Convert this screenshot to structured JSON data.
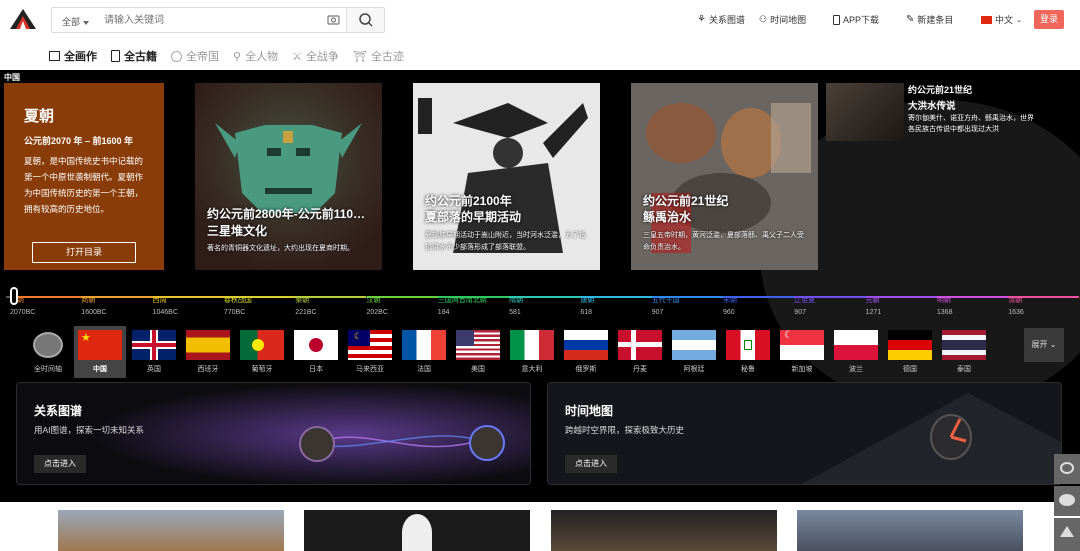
{
  "header": {
    "search_scope": "全部",
    "search_placeholder": "请输入关键词",
    "nav": [
      "关系图谱",
      "时间地图",
      "APP下载",
      "新建条目",
      "中文"
    ],
    "login": "登录"
  },
  "categories": [
    "全画作",
    "全古籍",
    "全帝国",
    "全人物",
    "全战争",
    "全古迹"
  ],
  "hero": {
    "label": "中国",
    "card": {
      "title": "夏朝",
      "dates": "公元前2070 年 – 前1600 年",
      "desc": "夏朝，是中国传统史书中记载的第一个中原世袭制朝代。夏朝作为中国传统历史的第一个王朝，拥有较高的历史地位。",
      "button": "打开目录"
    },
    "pictures": [
      {
        "title1": "约公元前2800年-公元前110…",
        "title2": "三星堆文化",
        "desc": "著名的青铜器文化遗址，大约出现在夏商时期。"
      },
      {
        "title1": "约公元前2100年",
        "title2": "夏部落的早期活动",
        "desc": "夏部族早期活动于嵩山附近，当时河水泛滥，为了抵抗洪水不少部落形成了部落联盟。"
      },
      {
        "title1": "约公元前21世纪",
        "title2": "鲧禹治水",
        "desc": "三皇五帝时期，黄河泛滥，夏部落鲧、禹父子二人受命负责治水。"
      }
    ],
    "side": {
      "title": "约公元前21世纪",
      "subtitle": "大洪水传说",
      "desc": "寄尔伽美什、诺亚方舟、鲧禹治水，世界各民族古传说中都出现过大洪"
    }
  },
  "timeline": [
    {
      "name": "夏朝",
      "year": "2070BC",
      "color": "#f07a2a"
    },
    {
      "name": "商朝",
      "year": "1600BC",
      "color": "#f0a030"
    },
    {
      "name": "西周",
      "year": "1046BC",
      "color": "#e8c230"
    },
    {
      "name": "春秋战国",
      "year": "770BC",
      "color": "#d8d030"
    },
    {
      "name": "秦朝",
      "year": "221BC",
      "color": "#b8d040"
    },
    {
      "name": "汉朝",
      "year": "202BC",
      "color": "#6cd040"
    },
    {
      "name": "三国两晋南北朝",
      "year": "184",
      "color": "#30c860"
    },
    {
      "name": "隋朝",
      "year": "581",
      "color": "#30c8b0"
    },
    {
      "name": "唐朝",
      "year": "618",
      "color": "#30b8e0"
    },
    {
      "name": "五代十国",
      "year": "907",
      "color": "#3088f0"
    },
    {
      "name": "宋朝",
      "year": "960",
      "color": "#4060f0"
    },
    {
      "name": "辽金夏",
      "year": "907",
      "color": "#7050f0"
    },
    {
      "name": "元朝",
      "year": "1271",
      "color": "#a050f0"
    },
    {
      "name": "明朝",
      "year": "1368",
      "color": "#d050e0"
    },
    {
      "name": "清朝",
      "year": "1636",
      "color": "#f050a0"
    }
  ],
  "countries": [
    "全时间轴",
    "中国",
    "英国",
    "西班牙",
    "葡萄牙",
    "日本",
    "马来西亚",
    "法国",
    "美国",
    "意大利",
    "俄罗斯",
    "丹麦",
    "阿根廷",
    "秘鲁",
    "新加坡",
    "波兰",
    "德国",
    "泰国"
  ],
  "expand": "展开",
  "features": [
    {
      "title": "关系图谱",
      "desc": "用AI图谱，探索一切未知关系",
      "button": "点击进入"
    },
    {
      "title": "时间地图",
      "desc": "跨越时空界限，探索极致大历史",
      "button": "点击进入"
    }
  ]
}
